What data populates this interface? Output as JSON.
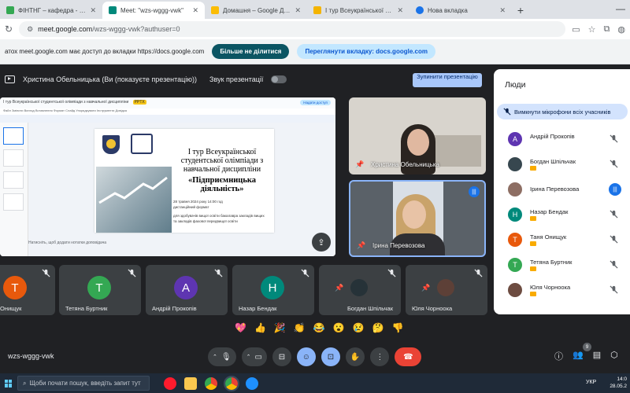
{
  "browser": {
    "tabs": [
      {
        "title": "ФІНТНГ – кафедра - Детальн",
        "favicon_color": "#34a853"
      },
      {
        "title": "Meet: \"wzs-wggg-vwk\"",
        "favicon_color": "#00897b",
        "active": true
      },
      {
        "title": "Домашня – Google Диск",
        "favicon_color": "#fbbc04"
      },
      {
        "title": "І тур Всеукраїнської студен",
        "favicon_color": "#f4b400"
      },
      {
        "title": "Нова вкладка",
        "favicon_color": "#1a73e8"
      }
    ],
    "url_host": "meet.google.com",
    "url_path": "/wzs-wggg-vwk?authuser=0",
    "infobar": {
      "text": "атох meet.google.com має доступ до вкладки https://docs.google.com",
      "stop_share_label": "Більше не ділитися",
      "switch_tab_label": "Переглянути вкладку: docs.google.com"
    }
  },
  "meet": {
    "presenting_label": "Христина Обельницька (Ви (показуєте презентацію))",
    "sound_label": "Звук презентації",
    "stop_presenting_label": "Зупинити презентацію",
    "meeting_code": "wzs-wggg-vwk",
    "shared_screen": {
      "doc_title": "І тур Всеукраїнської студентської олімпіади з навчальної дисципліни",
      "doc_badge": "PPTX",
      "share_label": "Надати доступ",
      "menu": "Файл  Змінити  Вигляд  Вставлення  Формат  Слайд  Упорядкувати  Інструменти  Довідка",
      "slide_title": "І тур Всеукраїнської студентської олімпіади з навчальної дисципліни",
      "slide_subject": "«Підприємницька діяльність»",
      "slide_date": "28 травня 2024 року 14:00 год",
      "slide_format": "дистанційний формат",
      "slide_for1": "для здобувачів вищої освіти бакалавра закладів вищих",
      "slide_for2": "та закладів фахової передвищої освіти",
      "notes_label": "Натисніть, щоб додати нотатки доповідача"
    },
    "cameras": [
      {
        "name": "Христина Обельницька"
      },
      {
        "name": "Ірина Перевозова"
      }
    ],
    "strip": [
      {
        "name": "Онищук",
        "initial": "Т",
        "color": "#e8590c"
      },
      {
        "name": "Тетяна Буртник",
        "initial": "Т",
        "color": "#34a853"
      },
      {
        "name": "Андрій Прокопів",
        "initial": "А",
        "color": "#5e35b1"
      },
      {
        "name": "Назар Бендак",
        "initial": "Н",
        "color": "#00897b"
      },
      {
        "name": "Богдан Шпільчак",
        "initial": "",
        "color": "#3c4043"
      },
      {
        "name": "Юля Чорноока",
        "initial": "",
        "color": "#3c4043"
      }
    ],
    "reactions": [
      "💖",
      "👍",
      "🎉",
      "👏",
      "😂",
      "😮",
      "😢",
      "🤔",
      "👎"
    ],
    "people_badge": "9"
  },
  "people_panel": {
    "title": "Люди",
    "mute_all_label": "Вимкнути мікрофони всіх учасників",
    "participants": [
      {
        "name": "Андрій Прокопів",
        "initial": "А",
        "color": "#5e35b1",
        "speaking": false
      },
      {
        "name": "Богдан Шпільчак",
        "initial": "",
        "color": "#37474f",
        "speaking": false
      },
      {
        "name": "Ірина Перевозова",
        "initial": "",
        "color": "#8d6e63",
        "speaking": true
      },
      {
        "name": "Назар Бендак",
        "initial": "Н",
        "color": "#00897b",
        "speaking": false
      },
      {
        "name": "Таня Онищук",
        "initial": "Т",
        "color": "#e8590c",
        "speaking": false
      },
      {
        "name": "Тетяна Буртник",
        "initial": "Т",
        "color": "#34a853",
        "speaking": false
      },
      {
        "name": "Юля Чорноока",
        "initial": "",
        "color": "#6d4c41",
        "speaking": false
      }
    ]
  },
  "taskbar": {
    "search_placeholder": "Щоби почати пошук, введіть запит тут",
    "lang": "УКР",
    "time": "14:0",
    "date": "28.05.2"
  }
}
